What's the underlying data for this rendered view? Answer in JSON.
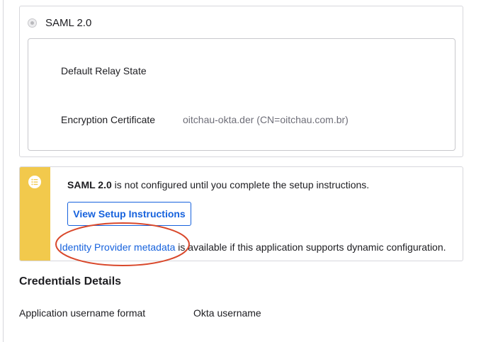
{
  "saml_option": {
    "title": "SAML 2.0",
    "fields": [
      {
        "label": "Default Relay State",
        "value": ""
      },
      {
        "label": "Encryption Certificate",
        "value": "oitchau-okta.der (CN=oitchau.com.br)"
      }
    ]
  },
  "callout": {
    "icon": "list-icon",
    "accent_color": "#f2c94c",
    "message_bold": "SAML 2.0",
    "message_rest": " is not configured until you complete the setup instructions.",
    "button_label": "View Setup Instructions",
    "metadata_link": "Identity Provider metadata",
    "metadata_rest": " is available if this application supports dynamic configuration."
  },
  "highlight_color": "#d9482b",
  "credentials": {
    "heading": "Credentials Details",
    "rows": [
      {
        "label": "Application username format",
        "value": "Okta username"
      }
    ]
  }
}
